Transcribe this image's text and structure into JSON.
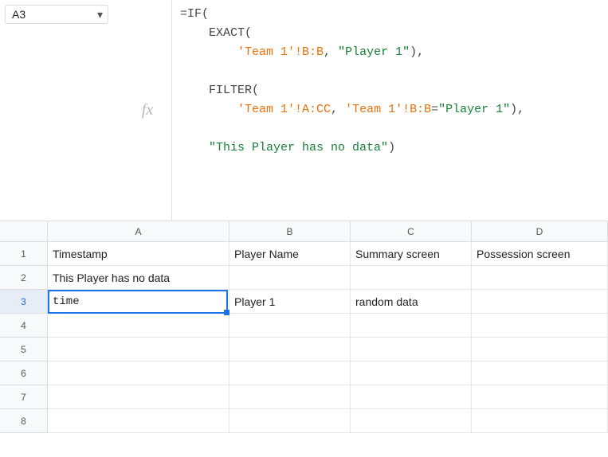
{
  "nameBox": {
    "value": "A3"
  },
  "formula": {
    "line1_eq": "=",
    "line1_if": "IF",
    "line1_paren": "(",
    "line2_indent": "    ",
    "line2_exact": "EXACT",
    "line2_paren": "(",
    "line3_indent": "        ",
    "line3_ref1": "'Team 1'!B:B",
    "line3_comma": ", ",
    "line3_str": "\"Player 1\"",
    "line3_close": "),",
    "line5_indent": "    ",
    "line5_filter": "FILTER",
    "line5_paren": "(",
    "line6_indent": "        ",
    "line6_ref1": "'Team 1'!A:CC",
    "line6_comma": ", ",
    "line6_ref2": "'Team 1'!B:B",
    "line6_eq": "=",
    "line6_str": "\"Player 1\"",
    "line6_close": "),",
    "line8_indent": "    ",
    "line8_str": "\"This Player has no data\"",
    "line8_close": ")"
  },
  "columns": {
    "A": "A",
    "B": "B",
    "C": "C",
    "D": "D"
  },
  "rows": {
    "1": "1",
    "2": "2",
    "3": "3",
    "4": "4",
    "5": "5",
    "6": "6",
    "7": "7",
    "8": "8"
  },
  "cells": {
    "A1": "Timestamp",
    "B1": "Player Name",
    "C1": "Summary screen",
    "D1": "Possession screen",
    "A2": "This Player has no data",
    "A3": "time",
    "B3": "Player 1",
    "C3": "random data"
  }
}
